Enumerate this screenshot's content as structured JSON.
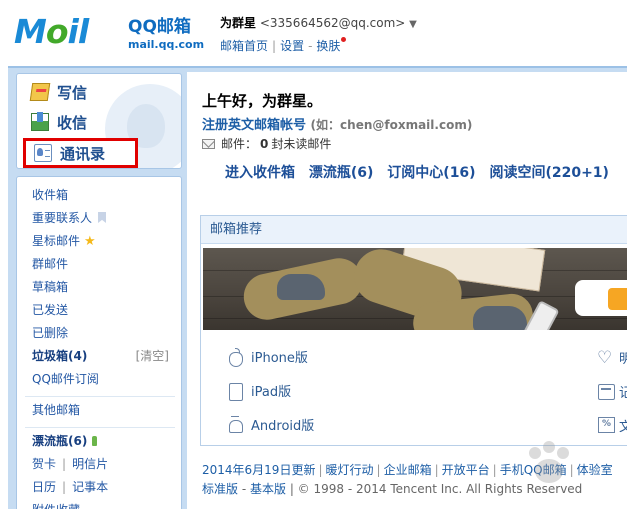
{
  "brand": {
    "logo_text_blue": "M",
    "logo_text_green": "o",
    "logo_text_rest": "il",
    "name": "QQ邮箱",
    "url": "mail.qq.com"
  },
  "user": {
    "name": "为群星",
    "email": "<335664562@qq.com>",
    "caret": "▼"
  },
  "top_links": {
    "home": "邮箱首页",
    "settings": "设置",
    "skin": "换肤"
  },
  "actions": {
    "write": "写信",
    "inbox": "收信",
    "contacts": "通讯录"
  },
  "nav": {
    "inbox": "收件箱",
    "vip": "重要联系人",
    "starred": "星标邮件",
    "groups": "群邮件",
    "drafts": "草稿箱",
    "sent": "已发送",
    "deleted": "已删除",
    "spam": "垃圾箱(4)",
    "spam_clear": "[清空]",
    "subscribe": "QQ邮件订阅",
    "other": "其他邮箱",
    "drift": "漂流瓶(6)",
    "card": "贺卡",
    "postcard": "明信片",
    "calendar": "日历",
    "notes": "记事本",
    "attach": "附件收藏"
  },
  "main": {
    "greeting_prefix": "上午好，",
    "greeting_name": "为群星",
    "greeting_suffix": "。",
    "register": "注册英文邮箱帐号",
    "register_hint": "(如：chen@foxmail.com)",
    "unread_prefix": "邮件：",
    "unread_count": "0",
    "unread_suffix": "封未读邮件",
    "quick": [
      "进入收件箱",
      "漂流瓶(6)",
      "订阅中心(16)",
      "阅读空间(220+1)"
    ]
  },
  "recommend": {
    "title": "邮箱推荐",
    "apps": [
      "iPhone版",
      "iPad版",
      "Android版"
    ],
    "right_labels": [
      "明",
      "记",
      "文"
    ],
    "right_icons": [
      "heart-icon",
      "calendar-icon",
      "document-icon"
    ]
  },
  "footer": {
    "links": [
      "2014年6月19日更新",
      "暖灯行动",
      "企业邮箱",
      "开放平台",
      "手机QQ邮箱",
      "体验室"
    ],
    "version_standard": "标准版",
    "version_basic": "基本版",
    "copyright": "© 1998 - 2014 Tencent Inc. All Rights Reserved"
  }
}
